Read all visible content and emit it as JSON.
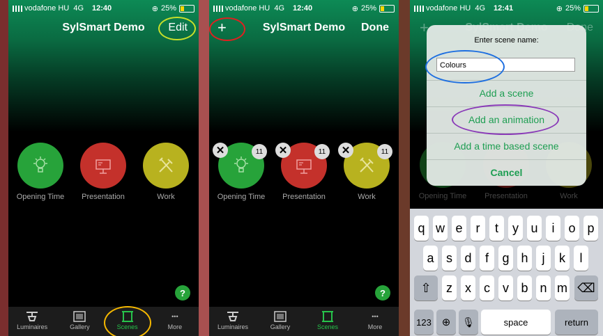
{
  "status": {
    "carrier": "vodafone HU",
    "network": "4G",
    "battery": "25%",
    "times": [
      "12:40",
      "12:40",
      "12:41"
    ]
  },
  "screen1": {
    "title": "SylSmart Demo",
    "right_button": "Edit"
  },
  "screen2": {
    "title": "SylSmart Demo",
    "left_button": "+",
    "right_button": "Done"
  },
  "screen3": {
    "title": "SylSmart Demo",
    "right_button": "Done",
    "dialog": {
      "title": "Enter scene name:",
      "input_value": "Colours",
      "options": [
        "Add a scene",
        "Add an animation",
        "Add a time based scene"
      ],
      "cancel": "Cancel"
    }
  },
  "scenes": [
    {
      "label": "Opening Time",
      "icon": "lightbulb-icon",
      "color": "#27a33a",
      "count": "11"
    },
    {
      "label": "Presentation",
      "icon": "projector-icon",
      "color": "#c4312b",
      "count": "11"
    },
    {
      "label": "Work",
      "icon": "tools-icon",
      "color": "#b8b21f",
      "count": "11"
    }
  ],
  "help": "?",
  "tabs": [
    {
      "label": "Luminaires",
      "icon": "luminaire-icon"
    },
    {
      "label": "Gallery",
      "icon": "gallery-icon"
    },
    {
      "label": "Scenes",
      "icon": "scenes-icon"
    },
    {
      "label": "More",
      "icon": "more-icon",
      "glyph": "•••"
    }
  ],
  "keyboard": {
    "row1": [
      "q",
      "w",
      "e",
      "r",
      "t",
      "y",
      "u",
      "i",
      "o",
      "p"
    ],
    "row2": [
      "a",
      "s",
      "d",
      "f",
      "g",
      "h",
      "j",
      "k",
      "l"
    ],
    "row3": [
      "z",
      "x",
      "c",
      "v",
      "b",
      "n",
      "m"
    ],
    "numbers": "123",
    "space": "space",
    "return": "return"
  },
  "annotation_colors": {
    "edit_ring": "#c8e02a",
    "scenes_ring": "#f5b800",
    "plus_ring": "#e02020",
    "input_ring": "#1e6fe0",
    "animation_ring": "#8a3ab8"
  }
}
